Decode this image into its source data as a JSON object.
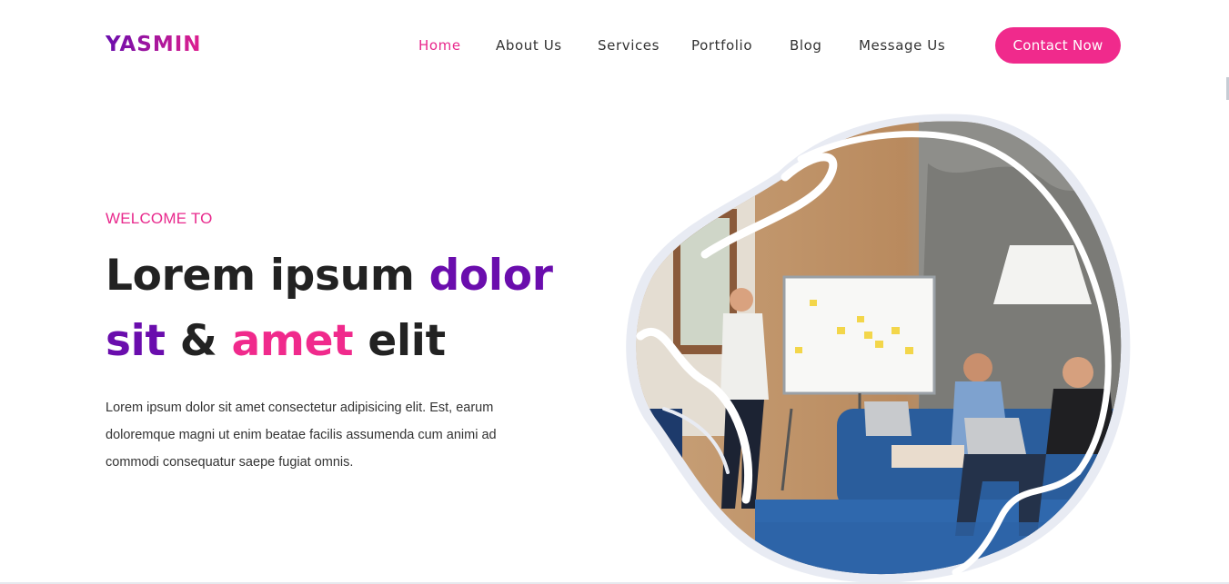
{
  "brand": {
    "logo": "YASMIN"
  },
  "nav": {
    "items": [
      {
        "label": "Home",
        "active": true
      },
      {
        "label": "About Us",
        "active": false
      },
      {
        "label": "Services",
        "active": false
      },
      {
        "label": "Portfolio",
        "active": false
      },
      {
        "label": "Blog",
        "active": false
      },
      {
        "label": "Message Us",
        "active": false
      }
    ],
    "cta_label": "Contact Now"
  },
  "hero": {
    "eyebrow": "WELCOME TO",
    "headline": {
      "w1": "Lorem ipsum ",
      "w2": "dolor",
      "w3": "sit",
      "w4": " & ",
      "w5": "amet",
      "w6": " elit"
    },
    "description": "Lorem ipsum dolor sit amet consectetur adipisicing elit. Est, earum doloremque magni ut enim beatae facilis assumenda cum animi ad commodi consequatur saepe fugiat omnis.",
    "image_alt": "team-meeting-photo"
  },
  "colors": {
    "accent_pink": "#f02a8c",
    "accent_purple": "#6a0dad",
    "text_dark": "#222222",
    "text_body": "#333333"
  }
}
